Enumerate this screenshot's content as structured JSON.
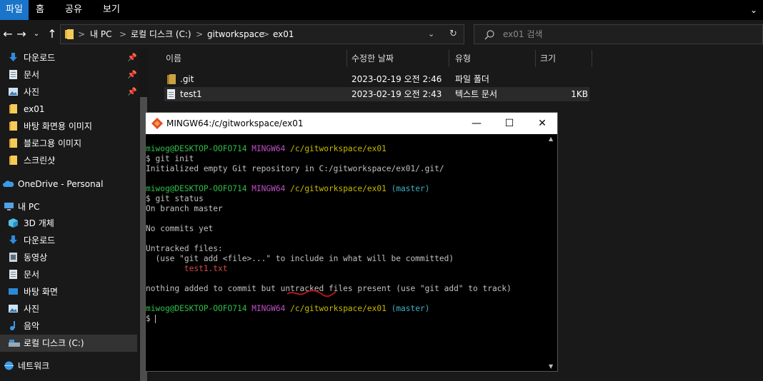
{
  "ribbon": {
    "tabs": [
      "파일",
      "홈",
      "공유",
      "보기"
    ],
    "expand_glyph": "⌄"
  },
  "address": {
    "crumbs": [
      "내 PC",
      "로컬 디스크 (C:)",
      "gitworkspace",
      "ex01"
    ],
    "separator": ">"
  },
  "search": {
    "placeholder": "ex01 검색"
  },
  "sidebar": {
    "items": [
      {
        "label": "다운로드",
        "icon": "download-icon",
        "pinned": true
      },
      {
        "label": "문서",
        "icon": "document-icon",
        "pinned": true
      },
      {
        "label": "사진",
        "icon": "picture-icon",
        "pinned": true
      },
      {
        "label": "ex01",
        "icon": "folder-icon",
        "pinned": false
      },
      {
        "label": "바탕 화면용 이미지",
        "icon": "folder-icon",
        "pinned": false
      },
      {
        "label": "블로그용 이미지",
        "icon": "folder-icon",
        "pinned": false
      },
      {
        "label": "스크린샷",
        "icon": "folder-icon",
        "pinned": false
      },
      {
        "label": "OneDrive - Personal",
        "icon": "cloud-icon",
        "pinned": false
      },
      {
        "label": "내 PC",
        "icon": "pc-icon",
        "pinned": false
      },
      {
        "label": "3D 개체",
        "icon": "cube-icon",
        "pinned": false
      },
      {
        "label": "다운로드",
        "icon": "download-icon",
        "pinned": false
      },
      {
        "label": "동영상",
        "icon": "video-icon",
        "pinned": false
      },
      {
        "label": "문서",
        "icon": "document-icon",
        "pinned": false
      },
      {
        "label": "바탕 화면",
        "icon": "desktop-icon",
        "pinned": false
      },
      {
        "label": "사진",
        "icon": "picture-icon",
        "pinned": false
      },
      {
        "label": "음악",
        "icon": "music-icon",
        "pinned": false
      },
      {
        "label": "로컬 디스크 (C:)",
        "icon": "drive-icon",
        "pinned": false,
        "selected": true
      },
      {
        "label": "네트워크",
        "icon": "network-icon",
        "pinned": false
      }
    ]
  },
  "columns": {
    "name": "이름",
    "modified": "수정한 날짜",
    "type": "유형",
    "size": "크기"
  },
  "files": [
    {
      "name": ".git",
      "modified": "2023-02-19 오전 2:46",
      "type": "파일 폴더",
      "size": "",
      "icon": "folder-icon"
    },
    {
      "name": "test1",
      "modified": "2023-02-19 오전 2:43",
      "type": "텍스트 문서",
      "size": "1KB",
      "icon": "text-file-icon"
    }
  ],
  "terminal": {
    "title": "MINGW64:/c/gitworkspace/ex01",
    "controls": {
      "minimize": "—",
      "maximize": "☐",
      "close": "✕"
    },
    "prompt": {
      "user_host": "miwog@DESKTOP-OOFO714",
      "shell": "MINGW64",
      "path": "/c/gitworkspace/ex01",
      "branch": "(master)"
    },
    "lines": {
      "cmd1": "$ git init",
      "out1": "Initialized empty Git repository in C:/gitworkspace/ex01/.git/",
      "cmd2": "$ git status",
      "out2": "On branch master",
      "out3": "No commits yet",
      "out4": "Untracked files:",
      "out5": "  (use \"git add <file>...\" to include in what will be committed)",
      "out6": "        test1.txt",
      "out7": "nothing added to commit but untracked files present (use \"git add\" to track)",
      "cmd3": "$ "
    }
  },
  "colors": {
    "accent": "#1a74c9",
    "prompt_user": "#2fbf4a",
    "prompt_shell": "#c04fc4",
    "prompt_path": "#c8b900",
    "prompt_branch": "#3bb0c0",
    "untracked_file": "#d24a4a",
    "annotation_underline": "#b01818"
  }
}
